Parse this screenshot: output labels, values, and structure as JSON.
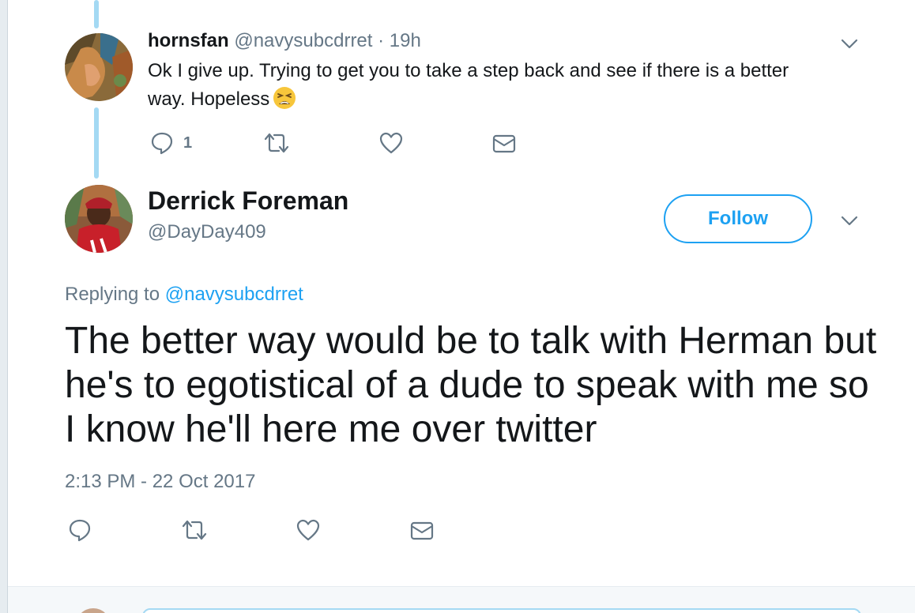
{
  "reply_tweet": {
    "name": "hornsfan",
    "handle": "@navysubcdrret",
    "separator": "·",
    "time": "19h",
    "text": "Ok I give up.  Trying to get you to take a step back and see if there is a better way.  Hopeless",
    "emoji": "weary-face-emoji",
    "actions": {
      "reply_count": "1",
      "icons": [
        "reply-icon",
        "retweet-icon",
        "like-icon",
        "dm-icon"
      ]
    }
  },
  "main_tweet": {
    "name": "Derrick Foreman",
    "handle": "@DayDay409",
    "follow_label": "Follow",
    "replying_prefix": "Replying to",
    "replying_to": "@navysubcdrret",
    "text": "The better way would be to talk with Herman but he's to egotistical of a dude to speak with me so I know he'll here me over twitter",
    "timestamp": "2:13 PM - 22 Oct 2017",
    "actions": {
      "icons": [
        "reply-icon",
        "retweet-icon",
        "like-icon",
        "dm-icon"
      ]
    }
  },
  "colors": {
    "accent": "#1da1f2",
    "thread_line": "#a4d9f3",
    "secondary_text": "#657786",
    "primary_text": "#14171a"
  }
}
